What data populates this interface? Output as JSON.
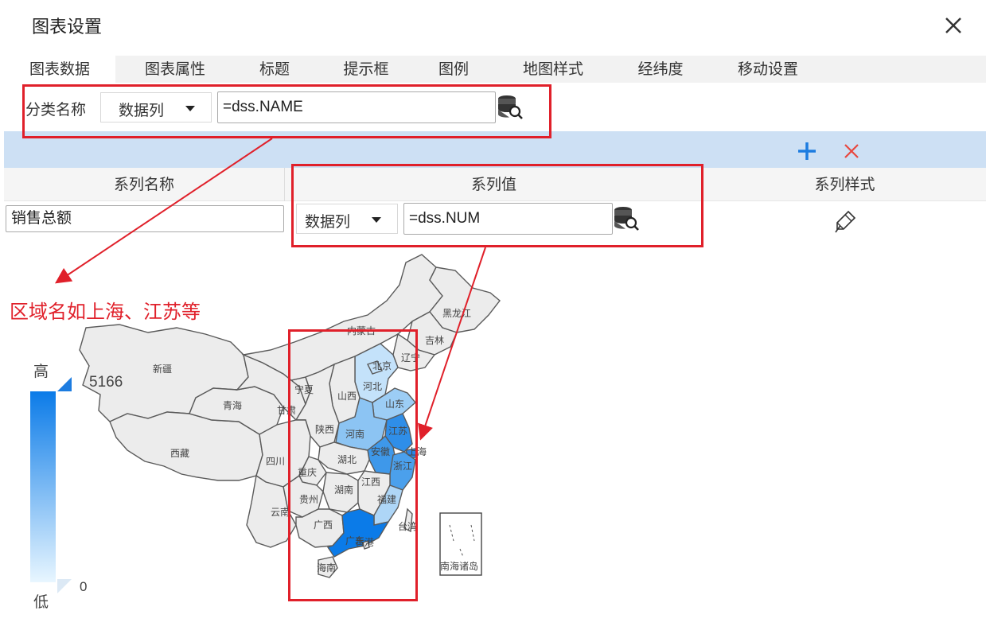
{
  "dialog": {
    "title": "图表设置",
    "close_icon": "close-icon"
  },
  "tabs": [
    "图表数据",
    "图表属性",
    "标题",
    "提示框",
    "图例",
    "地图样式",
    "经纬度",
    "移动设置"
  ],
  "category": {
    "label": "分类名称",
    "select_value": "数据列",
    "input_value": "=dss.NAME",
    "icon": "database-search-icon"
  },
  "toolbar": {
    "add_icon": "plus-icon",
    "delete_icon": "close-icon",
    "add_color": "#1c7ce0",
    "delete_color": "#e8483f"
  },
  "series_table": {
    "columns": [
      "系列名称",
      "系列值",
      "系列样式"
    ],
    "rows": [
      {
        "name": "销售总额",
        "value_select": "数据列",
        "value_input": "=dss.NUM",
        "value_icon": "database-search-icon",
        "style_icon": "brush-icon"
      }
    ]
  },
  "annotation": {
    "text": "区域名如上海、江苏等",
    "color": "#e0202a"
  },
  "map": {
    "legend": {
      "high_label": "高",
      "low_label": "低",
      "max_value": "5166",
      "min_value": "0",
      "color_high": "#0b7be8",
      "color_low": "#e8f6ff"
    },
    "provinces": [
      "新疆",
      "西藏",
      "青海",
      "甘肃",
      "宁夏",
      "内蒙古",
      "黑龙江",
      "吉林",
      "辽宁",
      "北京",
      "河北",
      "山西",
      "陕西",
      "山东",
      "河南",
      "江苏",
      "安徽",
      "上海",
      "浙江",
      "湖北",
      "湖南",
      "江西",
      "福建",
      "四川",
      "重庆",
      "贵州",
      "云南",
      "广西",
      "广东",
      "香港",
      "海南",
      "台湾",
      "南海诸岛"
    ],
    "highlight_colors": {
      "广东": "#0b7be8",
      "江苏": "#2f8ee8",
      "安徽": "#3e98ea",
      "浙江": "#4ba0ec",
      "上海": "#2a86e6",
      "河南": "#8cc4f3",
      "山东": "#9ccdf5",
      "河北": "#c4e2fa",
      "北京": "#c4e2fa",
      "福建": "#aed6f7",
      "default": "#ececec"
    }
  }
}
